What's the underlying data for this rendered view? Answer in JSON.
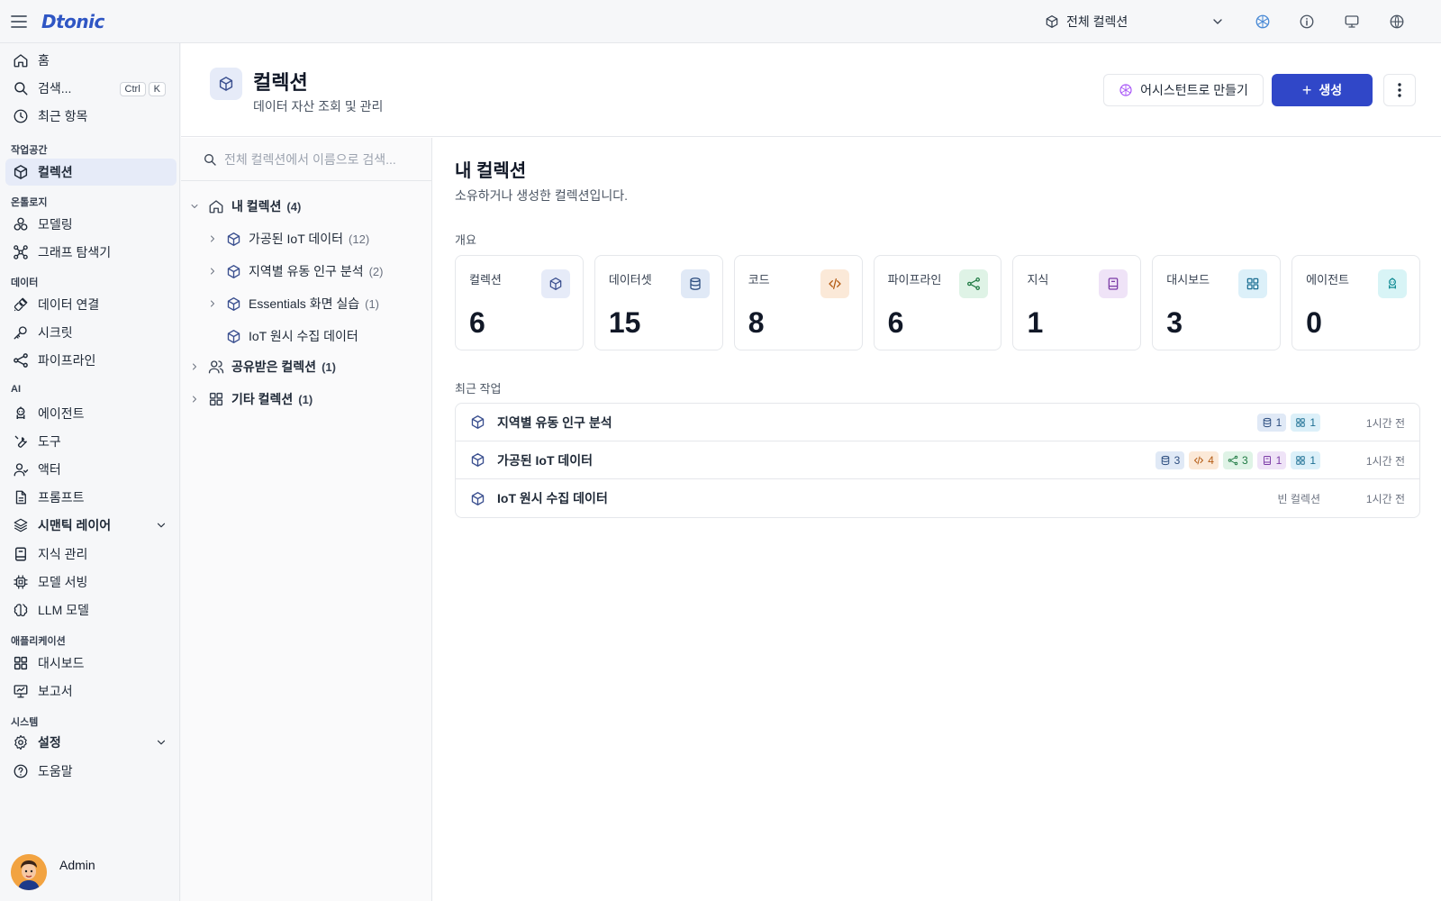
{
  "topbar": {
    "logo": "Dtonic",
    "scope_label": "전체 컬렉션"
  },
  "sidebar": {
    "home": "홈",
    "search": "검색...",
    "shortcut_ctrl": "Ctrl",
    "shortcut_k": "K",
    "recent": "최근 항목",
    "section_workspace": "작업공간",
    "collections": "컬렉션",
    "section_ontology": "온톨로지",
    "modeling": "모델링",
    "graph_explorer": "그래프 탐색기",
    "section_data": "데이터",
    "data_connection": "데이터 연결",
    "secrets": "시크릿",
    "pipeline": "파이프라인",
    "section_ai": "AI",
    "agents": "에이전트",
    "tools": "도구",
    "actors": "액터",
    "prompts": "프롬프트",
    "semantic_layer": "시맨틱 레이어",
    "knowledge": "지식 관리",
    "model_serving": "모델 서빙",
    "llm_models": "LLM 모델",
    "section_apps": "애플리케이션",
    "dashboards": "대시보드",
    "reports": "보고서",
    "section_system": "시스템",
    "settings": "설정",
    "help": "도움말",
    "user_name": "Admin"
  },
  "header": {
    "title": "컬렉션",
    "subtitle": "데이터 자산 조회 및 관리",
    "assistant_button": "어시스턴트로 만들기",
    "create_button": "생성"
  },
  "tree": {
    "search_placeholder": "전체 컬렉션에서 이름으로 검색...",
    "my_group": {
      "label": "내 컬렉션",
      "count": "(4)"
    },
    "my_items": [
      {
        "label": "가공된 IoT 데이터",
        "count": "(12)"
      },
      {
        "label": "지역별 유동 인구 분석",
        "count": "(2)"
      },
      {
        "label": "Essentials 화면 실습",
        "count": "(1)"
      },
      {
        "label": "IoT 원시 수집 데이터",
        "count": ""
      }
    ],
    "shared_group": {
      "label": "공유받은 컬렉션",
      "count": "(1)"
    },
    "other_group": {
      "label": "기타 컬렉션",
      "count": "(1)"
    }
  },
  "content": {
    "title": "내 컬렉션",
    "subtitle": "소유하거나 생성한 컬렉션입니다.",
    "overview_label": "개요",
    "recent_label": "최근 작업",
    "cards": [
      {
        "label": "컬렉션",
        "value": "6",
        "icon": "cube-icon",
        "bg": "#e6ebf8",
        "color": "#3a4f8f"
      },
      {
        "label": "데이터셋",
        "value": "15",
        "icon": "database-icon",
        "bg": "#e0e9f6",
        "color": "#2b4c7e"
      },
      {
        "label": "코드",
        "value": "8",
        "icon": "code-icon",
        "bg": "#fbe9d8",
        "color": "#b35a12"
      },
      {
        "label": "파이프라인",
        "value": "6",
        "icon": "pipeline-icon",
        "bg": "#dff3e6",
        "color": "#1f7a43"
      },
      {
        "label": "지식",
        "value": "1",
        "icon": "book-icon",
        "bg": "#efe3f7",
        "color": "#7b3aa6"
      },
      {
        "label": "대시보드",
        "value": "3",
        "icon": "dashboard-icon",
        "bg": "#dcf0f9",
        "color": "#1d6f93"
      },
      {
        "label": "에이전트",
        "value": "0",
        "icon": "robot-icon",
        "bg": "#d8f4f6",
        "color": "#0f8a93"
      }
    ],
    "recent": [
      {
        "name": "지역별 유동 인구 분석",
        "badges": {
          "db": "1",
          "dash": "1"
        },
        "time": "1시간 전"
      },
      {
        "name": "가공된 IoT 데이터",
        "badges": {
          "db": "3",
          "code": "4",
          "pipe": "3",
          "know": "1",
          "dash": "1"
        },
        "time": "1시간 전"
      },
      {
        "name": "IoT 원시 수집 데이터",
        "empty": "빈 컬렉션",
        "time": "1시간 전"
      }
    ]
  }
}
